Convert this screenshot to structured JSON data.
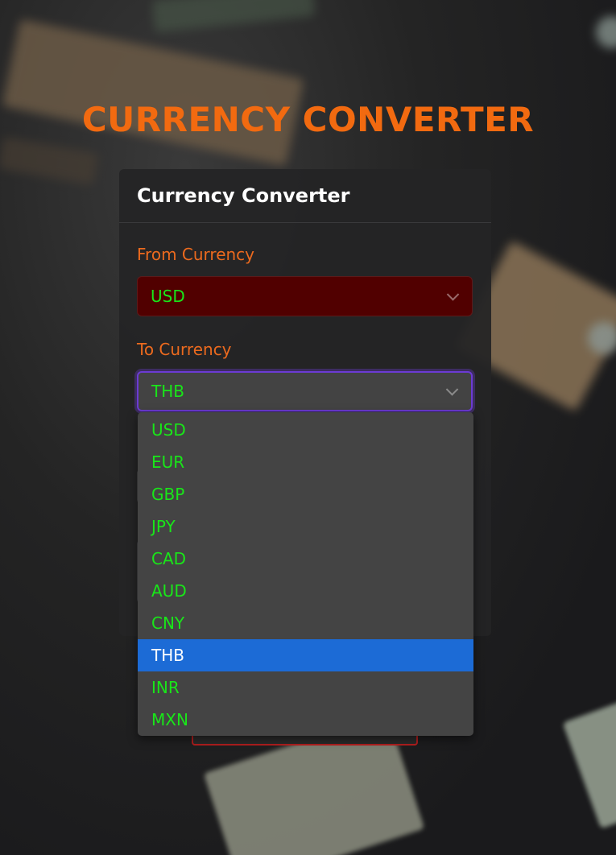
{
  "page": {
    "title": "CURRENCY CONVERTER"
  },
  "card": {
    "title": "Currency Converter",
    "from_label": "From Currency",
    "from_value": "USD",
    "to_label": "To Currency",
    "to_value": "THB"
  },
  "dropdown": {
    "options": [
      "USD",
      "EUR",
      "GBP",
      "JPY",
      "CAD",
      "AUD",
      "CNY",
      "THB",
      "INR",
      "MXN"
    ],
    "selected": "THB"
  },
  "colors": {
    "title_orange": "#f26a10",
    "label_orange": "#ec6a1e",
    "option_green": "#19e619",
    "selected_blue": "#1c6bd6",
    "from_select_bg": "#510000",
    "focus_purple": "#6c3bd4"
  },
  "icons": {
    "select_arrow": "chevron-down-icon"
  }
}
